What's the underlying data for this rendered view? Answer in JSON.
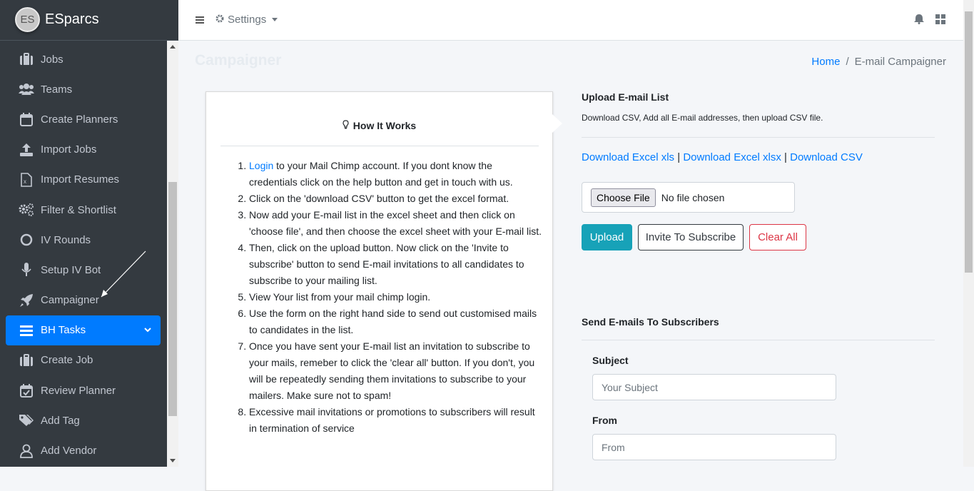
{
  "brand": {
    "logo_text": "ES",
    "name": "ESparcs"
  },
  "sidebar": {
    "items": [
      {
        "label": "Jobs",
        "icon": "briefcase-icon"
      },
      {
        "label": "Teams",
        "icon": "users-icon"
      },
      {
        "label": "Create Planners",
        "icon": "calendar-icon"
      },
      {
        "label": "Import Jobs",
        "icon": "upload-icon"
      },
      {
        "label": "Import Resumes",
        "icon": "excel-file-icon"
      },
      {
        "label": "Filter & Shortlist",
        "icon": "gears-icon"
      },
      {
        "label": "IV Rounds",
        "icon": "circle-icon"
      },
      {
        "label": "Setup IV Bot",
        "icon": "microphone-icon"
      },
      {
        "label": "Campaigner",
        "icon": "rocket-icon"
      },
      {
        "label": "BH Tasks",
        "icon": "list-icon",
        "active": true
      },
      {
        "label": "Create Job",
        "icon": "briefcase-icon"
      },
      {
        "label": "Review Planner",
        "icon": "calendar-check-icon"
      },
      {
        "label": "Add Tag",
        "icon": "tags-icon"
      },
      {
        "label": "Add Vendor",
        "icon": "user-icon"
      }
    ]
  },
  "topbar": {
    "settings_label": "Settings"
  },
  "page": {
    "title": "Campaigner",
    "breadcrumb": {
      "home": "Home",
      "separator": "/",
      "current": "E-mail Campaigner"
    }
  },
  "how_it_works": {
    "title": "How It Works",
    "steps": [
      {
        "link": "Login",
        "text": " to your Mail Chimp account. If you dont know the credentials click on the help button and get in touch with us."
      },
      {
        "text": "Click on the 'download CSV' button to get the excel format."
      },
      {
        "text": "Now add your E-mail list in the excel sheet and then click on 'choose file', and then choose the excel sheet with your E-mail list."
      },
      {
        "text": "Then, click on the upload button. Now click on the 'Invite to subscribe' button to send E-mail invitations to all candidates to subscribe to your mailing list."
      },
      {
        "text": "View Your list from your mail chimp login."
      },
      {
        "text": "Use the form on the right hand side to send out customised mails to candidates in the list."
      },
      {
        "text": "Once you have sent your E-mail list an invitation to subscribe to your mails, remeber to click the 'clear all' button. If you don't, you will be repeatedly sending them invitations to subscribe to your mailers. Make sure not to spam!"
      },
      {
        "text": "Excessive mail invitations or promotions to subscribers will result in termination of service"
      }
    ]
  },
  "upload": {
    "title": "Upload E-mail List",
    "description": "Download CSV, Add all E-mail addresses, then upload CSV file.",
    "links": [
      "Download Excel xls",
      "Download Excel xlsx",
      "Download CSV"
    ],
    "link_sep": "|",
    "file_button": "Choose File",
    "file_status": "No file chosen",
    "upload_button": "Upload",
    "invite_button": "Invite To Subscribe",
    "clear_button": "Clear All"
  },
  "send": {
    "title": "Send E-mails To Subscribers",
    "subject_label": "Subject",
    "subject_placeholder": "Your Subject",
    "from_label": "From",
    "from_placeholder": "From"
  }
}
